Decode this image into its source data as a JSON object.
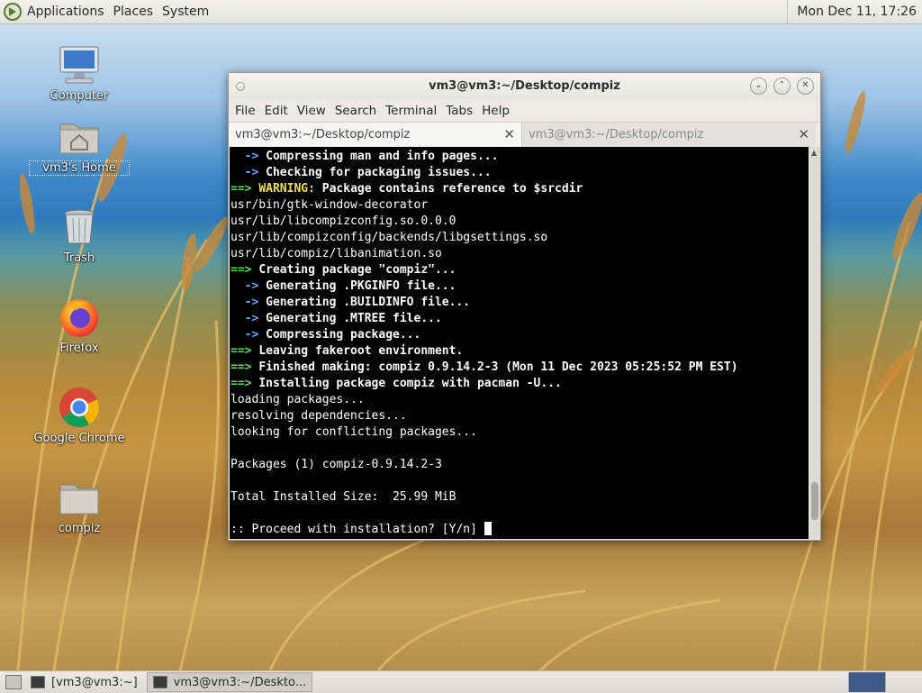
{
  "top_panel": {
    "menus": [
      "Applications",
      "Places",
      "System"
    ],
    "clock": "Mon Dec 11, 17:26"
  },
  "desktop_icons": [
    {
      "label": "Computer",
      "icon": "computer-icon"
    },
    {
      "label": "vm3's Home",
      "icon": "home-folder-icon"
    },
    {
      "label": "Trash",
      "icon": "trash-icon"
    },
    {
      "label": "Firefox",
      "icon": "firefox-icon"
    },
    {
      "label": "Google Chrome",
      "icon": "chrome-icon"
    },
    {
      "label": "compiz",
      "icon": "folder-icon"
    }
  ],
  "window": {
    "title": "vm3@vm3:~/Desktop/compiz",
    "menu": [
      "File",
      "Edit",
      "View",
      "Search",
      "Terminal",
      "Tabs",
      "Help"
    ],
    "tabs": [
      {
        "label": "vm3@vm3:~/Desktop/compiz",
        "active": true
      },
      {
        "label": "vm3@vm3:~/Desktop/compiz",
        "active": false
      }
    ],
    "close_glyph": "✕"
  },
  "terminal": {
    "lines": [
      {
        "prefix": "  -> ",
        "prefix_style": "bl",
        "text": "Compressing man and info pages...",
        "style": "b"
      },
      {
        "prefix": "  -> ",
        "prefix_style": "bl",
        "text": "Checking for packaging issues...",
        "style": "b"
      },
      {
        "prefix": "==> ",
        "prefix_style": "g",
        "warn": "WARNING:",
        "text": " Package contains reference to $srcdir",
        "style": "b"
      },
      {
        "prefix": "",
        "text": "usr/bin/gtk-window-decorator"
      },
      {
        "prefix": "",
        "text": "usr/lib/libcompizconfig.so.0.0.0"
      },
      {
        "prefix": "",
        "text": "usr/lib/compizconfig/backends/libgsettings.so"
      },
      {
        "prefix": "",
        "text": "usr/lib/compiz/libanimation.so"
      },
      {
        "prefix": "==> ",
        "prefix_style": "g",
        "text": "Creating package \"compiz\"...",
        "style": "b"
      },
      {
        "prefix": "  -> ",
        "prefix_style": "bl",
        "text": "Generating .PKGINFO file...",
        "style": "b"
      },
      {
        "prefix": "  -> ",
        "prefix_style": "bl",
        "text": "Generating .BUILDINFO file...",
        "style": "b"
      },
      {
        "prefix": "  -> ",
        "prefix_style": "bl",
        "text": "Generating .MTREE file...",
        "style": "b"
      },
      {
        "prefix": "  -> ",
        "prefix_style": "bl",
        "text": "Compressing package...",
        "style": "b"
      },
      {
        "prefix": "==> ",
        "prefix_style": "g",
        "text": "Leaving fakeroot environment.",
        "style": "b"
      },
      {
        "prefix": "==> ",
        "prefix_style": "g",
        "text": "Finished making: compiz 0.9.14.2-3 (Mon 11 Dec 2023 05:25:52 PM EST)",
        "style": "b"
      },
      {
        "prefix": "==> ",
        "prefix_style": "g",
        "text": "Installing package compiz with pacman -U...",
        "style": "b"
      },
      {
        "prefix": "",
        "text": "loading packages..."
      },
      {
        "prefix": "",
        "text": "resolving dependencies..."
      },
      {
        "prefix": "",
        "text": "looking for conflicting packages..."
      },
      {
        "prefix": "",
        "text": ""
      },
      {
        "prefix": "",
        "text": "Packages (1) compiz-0.9.14.2-3"
      },
      {
        "prefix": "",
        "text": ""
      },
      {
        "prefix": "",
        "text": "Total Installed Size:  25.99 MiB"
      },
      {
        "prefix": "",
        "text": ""
      },
      {
        "prefix": "",
        "text": ":: Proceed with installation? [Y/n] ",
        "cursor": true
      }
    ]
  },
  "taskbar": {
    "items": [
      {
        "label": "[vm3@vm3:~]",
        "active": false
      },
      {
        "label": "vm3@vm3:~/Deskto...",
        "active": true
      }
    ]
  },
  "colors": {
    "terminal_bg": "#000000",
    "prompt_green": "#58e058",
    "arrow_blue": "#6fa6ff",
    "warning_yellow": "#f0e060"
  }
}
